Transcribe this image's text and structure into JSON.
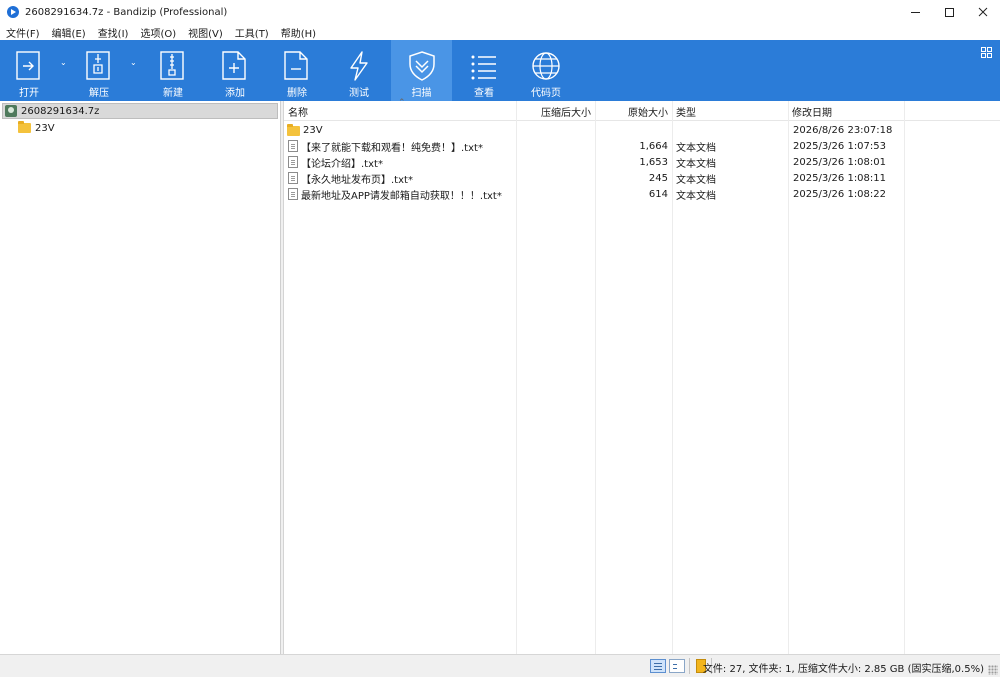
{
  "window": {
    "title": "2608291634.7z - Bandizip (Professional)",
    "icon": "bandizip-icon"
  },
  "menu": [
    "文件(F)",
    "编辑(E)",
    "查找(I)",
    "选项(O)",
    "视图(V)",
    "工具(T)",
    "帮助(H)"
  ],
  "toolbar": {
    "items": [
      {
        "label": "打开",
        "icon": "open-archive-icon"
      },
      {
        "label": "解压",
        "icon": "extract-icon"
      },
      {
        "label": "新建",
        "icon": "new-archive-icon"
      },
      {
        "label": "添加",
        "icon": "add-file-icon"
      },
      {
        "label": "删除",
        "icon": "delete-file-icon"
      },
      {
        "label": "测试",
        "icon": "test-bolt-icon"
      },
      {
        "label": "扫描",
        "icon": "scan-shield-icon"
      },
      {
        "label": "查看",
        "icon": "view-list-icon"
      },
      {
        "label": "代码页",
        "icon": "codepage-globe-icon"
      }
    ],
    "active": "扫描",
    "background": "#2b7cd8"
  },
  "tree": {
    "root": "2608291634.7z",
    "children": [
      "23V"
    ]
  },
  "list": {
    "columns": {
      "name": "名称",
      "packed": "压缩后大小",
      "size": "原始大小",
      "type": "类型",
      "modified": "修改日期"
    },
    "rows": [
      {
        "icon": "folder-icon",
        "name": "23V",
        "packed": "",
        "size": "",
        "type": "",
        "modified": "2026/8/26 23:07:18"
      },
      {
        "icon": "text-file-icon",
        "name": "【来了就能下载和观看！纯免费！】.txt*",
        "packed": "",
        "size": "1,664",
        "type": "文本文档",
        "modified": "2025/3/26 1:07:53"
      },
      {
        "icon": "text-file-icon",
        "name": "【论坛介绍】.txt*",
        "packed": "",
        "size": "1,653",
        "type": "文本文档",
        "modified": "2025/3/26 1:08:01"
      },
      {
        "icon": "text-file-icon",
        "name": "【永久地址发布页】.txt*",
        "packed": "",
        "size": "245",
        "type": "文本文档",
        "modified": "2025/3/26 1:08:11"
      },
      {
        "icon": "text-file-icon",
        "name": "最新地址及APP请发邮箱自动获取！！！.txt*",
        "packed": "",
        "size": "614",
        "type": "文本文档",
        "modified": "2025/3/26 1:08:22"
      }
    ]
  },
  "status": {
    "text": "文件: 27, 文件夹: 1, 压缩文件大小: 2.85 GB (固实压缩,0.5%)"
  }
}
